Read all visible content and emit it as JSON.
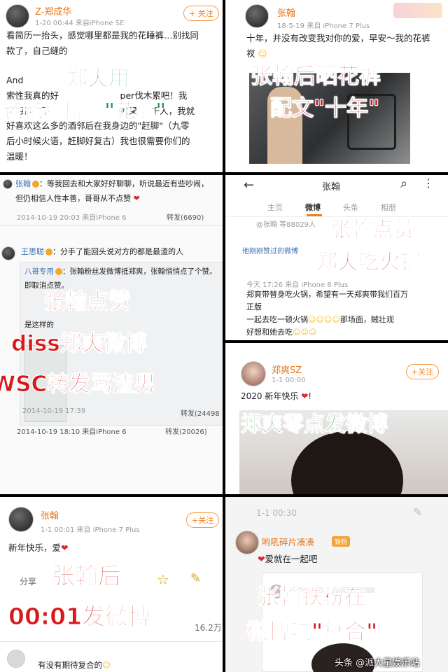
{
  "p1": {
    "username": "Z-郑成华",
    "meta": "1-20 00:44  来自iPhone SE",
    "follow": "+ 关注",
    "line1": "看简历一抬头，感觉哪里都是我的花睡裤…别找同",
    "line2": "款了，自己缝的",
    "line3": "And",
    "line4": "索性我真的好",
    "line4b": "per伐木累吧！我",
    "line5": "很想试一下",
    "line5b": "如果有?千人，我就",
    "line6": "好喜欢这么多的酒邻后在我身边的\"赶脚\"（九零",
    "line7": "后小时候火语，赶脚好复古）我也很需要你们的",
    "line8": "温暖！",
    "overlay1": "郑爽用",
    "overlay2": "爸爸微博晒\"花裤\""
  },
  "p2": {
    "username": "张翰",
    "meta": "18-5-19  来自 iPhone 7 Plus",
    "line1": "十年，并没有改变我对你的爱，早安～我的花裤",
    "line2": "衩",
    "overlay1": "张翰后晒花裤",
    "overlay2": "配文\"十年\""
  },
  "p3": {
    "top_user": "张翰",
    "top_text": "：等我回去和大家好好聊聊，听说最近有些吵闹，",
    "top_text2": "但仍相信人性本善，哥哥从不点赞",
    "top_meta": "2014-10-19 20:03  来自iPhone 6",
    "top_repost": "转发(6690)",
    "mid_user": "王思聪",
    "mid_text": "：分手了能回头说对方的都是最渣的人",
    "inner_label": "八哥专用",
    "inner_text": "：张翰粉丝发微博抵郑爽，张翰悄悄点了个赞。",
    "inner_text2": "即取消点赞。",
    "inner_text3": "是这样的",
    "inner_meta": "2014-10-19 17:39",
    "inner_repost": "转发(24498",
    "bottom_meta": "2014-10-19 18:10  来自iPhone 6",
    "bottom_repost": "转发(20026)",
    "overlay1": "张翰点赞",
    "overlay2": "diss郑爽微博",
    "overlay3": "WSC转发骂渣男"
  },
  "p4": {
    "header_title": "张翰",
    "tabs": [
      "主页",
      "微博",
      "头条",
      "相册"
    ],
    "active_tab": "微博",
    "fans": "@张翰 等88029人",
    "section": "他刚刚赞过的微博",
    "item_meta": "今天 17:26  来自 iPhone 6 Plus",
    "item_line1": "郑爽带替身吃火锅，希望有一天郑爽带我们百万",
    "item_line2": "正版",
    "item_line3": "一起去吃一顿火锅",
    "item_line3b": "那场面，贼壮观",
    "item_line4": "好想和她去吃",
    "overlay1": "张翰点赞",
    "overlay2": "郑爽吃火锅"
  },
  "p5": {
    "username": "郑爽SZ",
    "meta": "1-1 00:00",
    "follow": "+关注",
    "text": "2020 新年快乐",
    "overlay1": "郑爽零点发微博"
  },
  "p6": {
    "username": "张翰",
    "meta": "1-1 00:01  来自 iPhone 7 Plus",
    "follow": "+关注",
    "text": "新年快乐，爱",
    "share": "分享",
    "count": "16.2万",
    "comment": "有没有期待复合的",
    "overlay1": "张翰后",
    "overlay2": "00:01发微博"
  },
  "p7": {
    "meta": "1-1 00:30",
    "username": "哟吼碎片凑凑",
    "badge": "铁粉",
    "text": "爱就在一起吧",
    "overlay1": "张翰铁粉在",
    "overlay2": "微博喊\"复合\""
  },
  "watermark": "头条 @派大星娱乐站",
  "colors": {
    "overlay_red": "#d7191b",
    "overlay_green": "#1c9c3c",
    "weibo_orange": "#f08019"
  }
}
